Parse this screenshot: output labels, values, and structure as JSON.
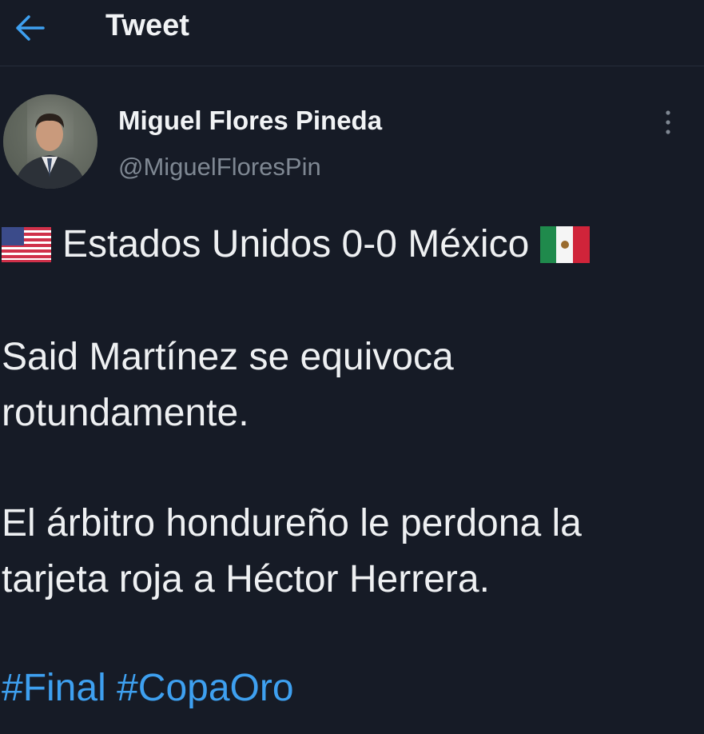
{
  "header": {
    "back_icon": "arrow-left-icon",
    "title": "Tweet"
  },
  "author": {
    "display_name": "Miguel Flores Pineda",
    "handle": "@MiguelFloresPin",
    "more_icon": "more-vertical-icon"
  },
  "tweet": {
    "score_line": "Estados Unidos 0-0 México",
    "flag_left": "us-flag-icon",
    "flag_right": "mexico-flag-icon",
    "para1_line1": "Said Martínez se equivoca",
    "para1_line2": "rotundamente.",
    "para2_line1": "El árbitro hondureño le perdona la",
    "para2_line2": "tarjeta roja a Héctor Herrera.",
    "hashtags": [
      "#Final",
      "#CopaOro"
    ]
  },
  "colors": {
    "background": "#161b26",
    "text": "#eef0f2",
    "accent": "#3ea0f0",
    "muted": "#7f8893"
  }
}
